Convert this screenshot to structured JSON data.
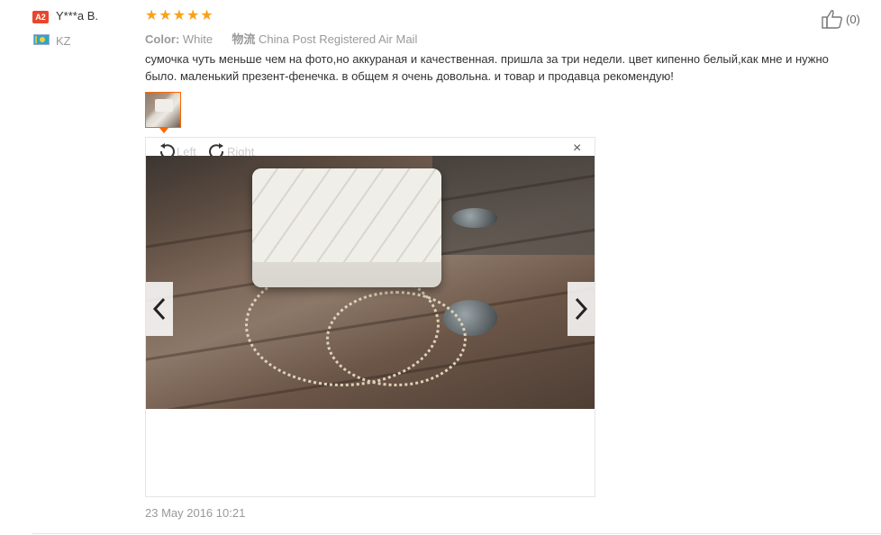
{
  "user": {
    "level_badge": "A2",
    "name": "Y***a B.",
    "country": "KZ"
  },
  "feedback": {
    "stars": 5,
    "color_label": "Color:",
    "color_value": "White",
    "logistics_label": "物流",
    "logistics_value": "China Post Registered Air Mail",
    "text": "сумочка чуть меньше чем на фото,но аккураная и качественная. пришла за три недели. цвет кипенно белый,как мне и нужно было. маленький презент-фенечка. в общем я очень довольна. и товар и продавца рекомендую!",
    "date": "23 May 2016 10:21"
  },
  "viewer": {
    "rotate_left_label": "Left",
    "rotate_right_label": "Right",
    "close_glyph": "×",
    "prev_icon": "chevron-left-icon",
    "next_icon": "chevron-right-icon"
  },
  "helpful": {
    "count": "(0)",
    "icon": "thumbs-up-icon"
  },
  "colors": {
    "star": "#f7a21a",
    "badge": "#e8462d",
    "thumb_border": "#ff6600",
    "muted_text": "#999999"
  }
}
